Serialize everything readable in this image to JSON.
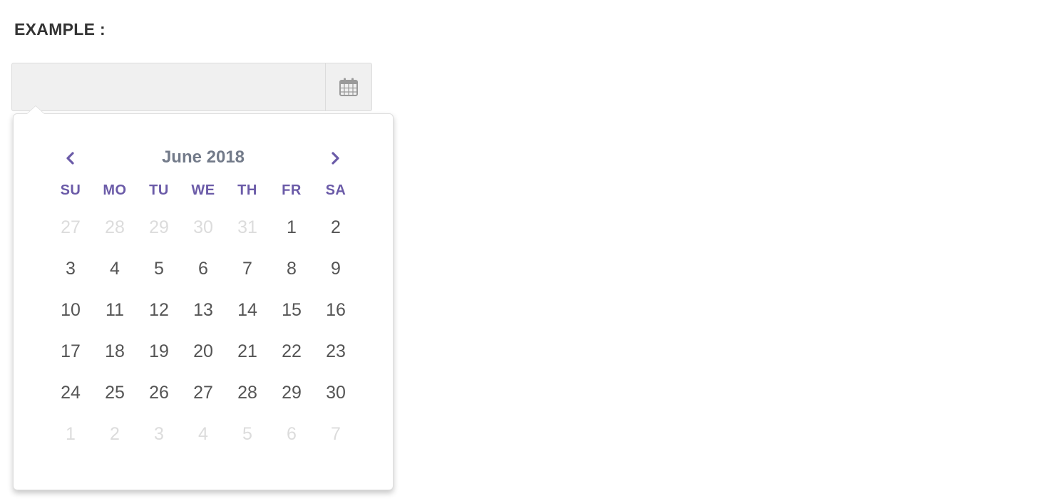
{
  "form": {
    "label": "EXAMPLE :",
    "input_value": "",
    "input_placeholder": ""
  },
  "calendar": {
    "title": "June 2018",
    "prev_icon": "chevron-left-icon",
    "next_icon": "chevron-right-icon",
    "weekdays": [
      "SU",
      "MO",
      "TU",
      "WE",
      "TH",
      "FR",
      "SA"
    ],
    "weeks": [
      [
        {
          "d": "27",
          "m": true
        },
        {
          "d": "28",
          "m": true
        },
        {
          "d": "29",
          "m": true
        },
        {
          "d": "30",
          "m": true
        },
        {
          "d": "31",
          "m": true
        },
        {
          "d": "1",
          "m": false
        },
        {
          "d": "2",
          "m": false
        }
      ],
      [
        {
          "d": "3",
          "m": false
        },
        {
          "d": "4",
          "m": false
        },
        {
          "d": "5",
          "m": false
        },
        {
          "d": "6",
          "m": false
        },
        {
          "d": "7",
          "m": false
        },
        {
          "d": "8",
          "m": false
        },
        {
          "d": "9",
          "m": false
        }
      ],
      [
        {
          "d": "10",
          "m": false
        },
        {
          "d": "11",
          "m": false
        },
        {
          "d": "12",
          "m": false
        },
        {
          "d": "13",
          "m": false
        },
        {
          "d": "14",
          "m": false
        },
        {
          "d": "15",
          "m": false
        },
        {
          "d": "16",
          "m": false
        }
      ],
      [
        {
          "d": "17",
          "m": false
        },
        {
          "d": "18",
          "m": false
        },
        {
          "d": "19",
          "m": false
        },
        {
          "d": "20",
          "m": false
        },
        {
          "d": "21",
          "m": false
        },
        {
          "d": "22",
          "m": false
        },
        {
          "d": "23",
          "m": false
        }
      ],
      [
        {
          "d": "24",
          "m": false
        },
        {
          "d": "25",
          "m": false
        },
        {
          "d": "26",
          "m": false
        },
        {
          "d": "27",
          "m": false
        },
        {
          "d": "28",
          "m": false
        },
        {
          "d": "29",
          "m": false
        },
        {
          "d": "30",
          "m": false
        }
      ],
      [
        {
          "d": "1",
          "m": true
        },
        {
          "d": "2",
          "m": true
        },
        {
          "d": "3",
          "m": true
        },
        {
          "d": "4",
          "m": true
        },
        {
          "d": "5",
          "m": true
        },
        {
          "d": "6",
          "m": true
        },
        {
          "d": "7",
          "m": true
        }
      ]
    ]
  },
  "colors": {
    "accent": "#6b5ba8",
    "title": "#737b8a",
    "day": "#555555",
    "muted_day": "#dcdcdc",
    "input_bg": "#f0f0f0"
  }
}
